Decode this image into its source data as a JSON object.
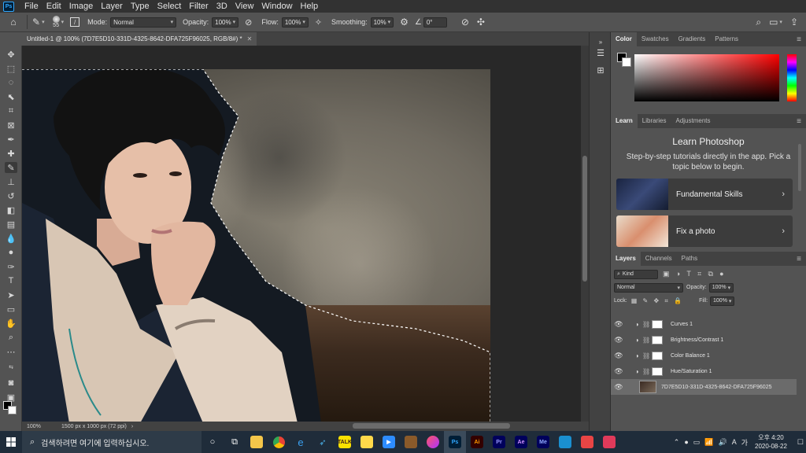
{
  "app": {
    "logo": "Ps",
    "logo_color": "#31a8ff"
  },
  "menu": [
    "File",
    "Edit",
    "Image",
    "Layer",
    "Type",
    "Select",
    "Filter",
    "3D",
    "View",
    "Window",
    "Help"
  ],
  "options": {
    "brush_size": "55",
    "mode_label": "Mode:",
    "mode_value": "Normal",
    "opacity_label": "Opacity:",
    "opacity_value": "100%",
    "flow_label": "Flow:",
    "flow_value": "100%",
    "smoothing_label": "Smoothing:",
    "smoothing_value": "10%",
    "angle_value": "0°"
  },
  "document": {
    "tab_title": "Untitled-1 @ 100% (7D7E5D10-331D-4325-8642-DFA725F96025, RGB/8#) *",
    "zoom": "100%",
    "info": "1500 px x 1000 px (72 ppi)"
  },
  "color_panel": {
    "tabs": [
      "Color",
      "Swatches",
      "Gradients",
      "Patterns"
    ],
    "active_tab": "Color"
  },
  "learn_panel": {
    "tabs": [
      "Learn",
      "Libraries",
      "Adjustments"
    ],
    "title": "Learn Photoshop",
    "description": "Step-by-step tutorials directly in the app. Pick a topic below to begin.",
    "cards": [
      "Fundamental Skills",
      "Fix a photo"
    ]
  },
  "layers_panel": {
    "tabs": [
      "Layers",
      "Channels",
      "Paths"
    ],
    "filter_kind": "Kind",
    "blend_mode": "Normal",
    "opacity_label": "Opacity:",
    "opacity_value": "100%",
    "lock_label": "Lock:",
    "fill_label": "Fill:",
    "fill_value": "100%",
    "layers": [
      {
        "name": "Curves 1",
        "type": "adjustment"
      },
      {
        "name": "Brightness/Contrast 1",
        "type": "adjustment"
      },
      {
        "name": "Color Balance 1",
        "type": "adjustment"
      },
      {
        "name": "Hue/Saturation 1",
        "type": "adjustment"
      },
      {
        "name": "7D7E5D10-331D-4325-8642-DFA725F96025",
        "type": "image",
        "selected": true
      }
    ]
  },
  "taskbar": {
    "search_placeholder": "검색하려면 여기에 입력하십시오.",
    "apps": [
      "Ai",
      "Pr",
      "Ae",
      "Me"
    ],
    "ime": "A",
    "lang": "가",
    "time": "오후 4:20",
    "date": "2020-08-22"
  }
}
